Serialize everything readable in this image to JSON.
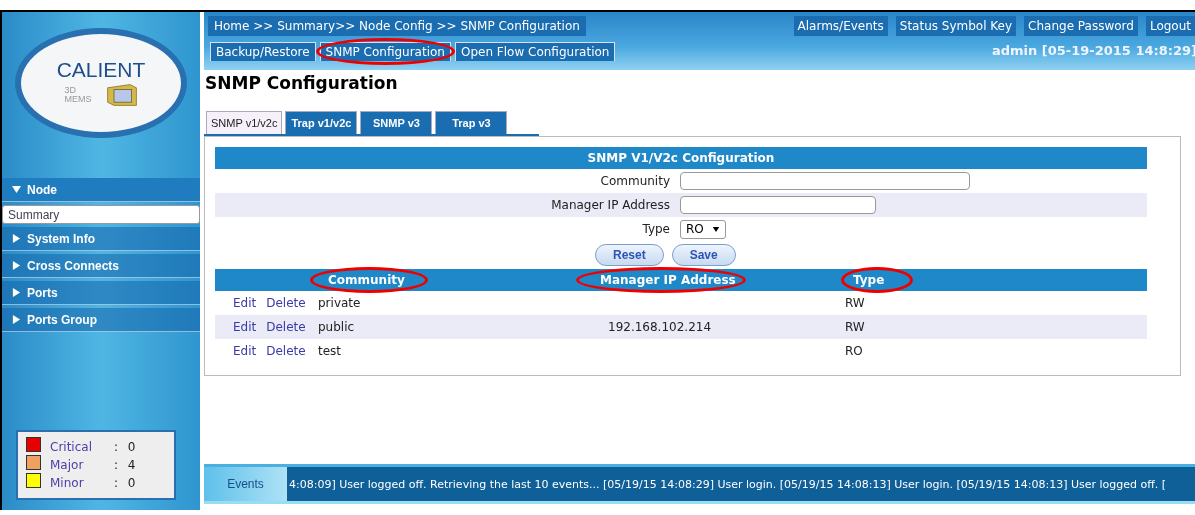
{
  "logo": {
    "name": "CALIENT",
    "sub_lines": [
      "3D",
      "MEMS"
    ]
  },
  "breadcrumb": "Home >> Summary>> Node Config >> SNMP Configuration",
  "header_links": [
    {
      "label": "Alarms/Events"
    },
    {
      "label": "Status Symbol Key"
    },
    {
      "label": "Change Password"
    },
    {
      "label": "Logout"
    }
  ],
  "user_status": "admin [05-19-2015 14:8:29]",
  "subnav": [
    {
      "label": "Backup/Restore",
      "highlighted": false
    },
    {
      "label": "SNMP Configuration",
      "highlighted": true
    },
    {
      "label": "Open Flow Configuration",
      "highlighted": false
    }
  ],
  "nav": [
    {
      "label": "Node",
      "expanded": true,
      "children": [
        {
          "label": "Summary",
          "selected": true
        }
      ]
    },
    {
      "label": "System Info",
      "expanded": false
    },
    {
      "label": "Cross Connects",
      "expanded": false
    },
    {
      "label": "Ports",
      "expanded": false
    },
    {
      "label": "Ports Group",
      "expanded": false
    }
  ],
  "alarm_summary": [
    {
      "label": "Critical",
      "count": ": 0",
      "color": "#e60000"
    },
    {
      "label": "Major",
      "count": ": 4",
      "color": "#f0a060"
    },
    {
      "label": "Minor",
      "count": ": 0",
      "color": "#ffff00"
    }
  ],
  "page_title": "SNMP Configuration",
  "tabs": [
    {
      "label": "SNMP v1/v2c",
      "selected": true
    },
    {
      "label": "Trap v1/v2c",
      "selected": false
    },
    {
      "label": "SNMP v3",
      "selected": false
    },
    {
      "label": "Trap v3",
      "selected": false
    }
  ],
  "form": {
    "title": "SNMP V1/V2c Configuration",
    "fields": [
      {
        "kind": "text",
        "label": "Community"
      },
      {
        "kind": "text",
        "label": "Manager IP Address"
      },
      {
        "kind": "select",
        "label": "Type",
        "value": "RO"
      }
    ],
    "buttons": [
      "Reset",
      "Save"
    ]
  },
  "table": {
    "columns": [
      {
        "label": "Community",
        "highlighted": true
      },
      {
        "label": "Manager IP Address",
        "highlighted": true
      },
      {
        "label": "Type",
        "highlighted": true
      }
    ],
    "rows": [
      {
        "actions": [
          "Edit",
          "Delete"
        ],
        "community": "private",
        "ip": "",
        "type": "RW"
      },
      {
        "actions": [
          "Edit",
          "Delete"
        ],
        "community": "public",
        "ip": "192.168.102.214",
        "type": "RW"
      },
      {
        "actions": [
          "Edit",
          "Delete"
        ],
        "community": "test",
        "ip": "",
        "type": "RO"
      }
    ]
  },
  "events": {
    "label": "Events",
    "text": "4:08:09] User logged off. Retrieving the last 10 events... [05/19/15 14:08:29] User login. [05/19/15 14:08:13] User login. [05/19/15 14:08:13] User logged off. ["
  }
}
